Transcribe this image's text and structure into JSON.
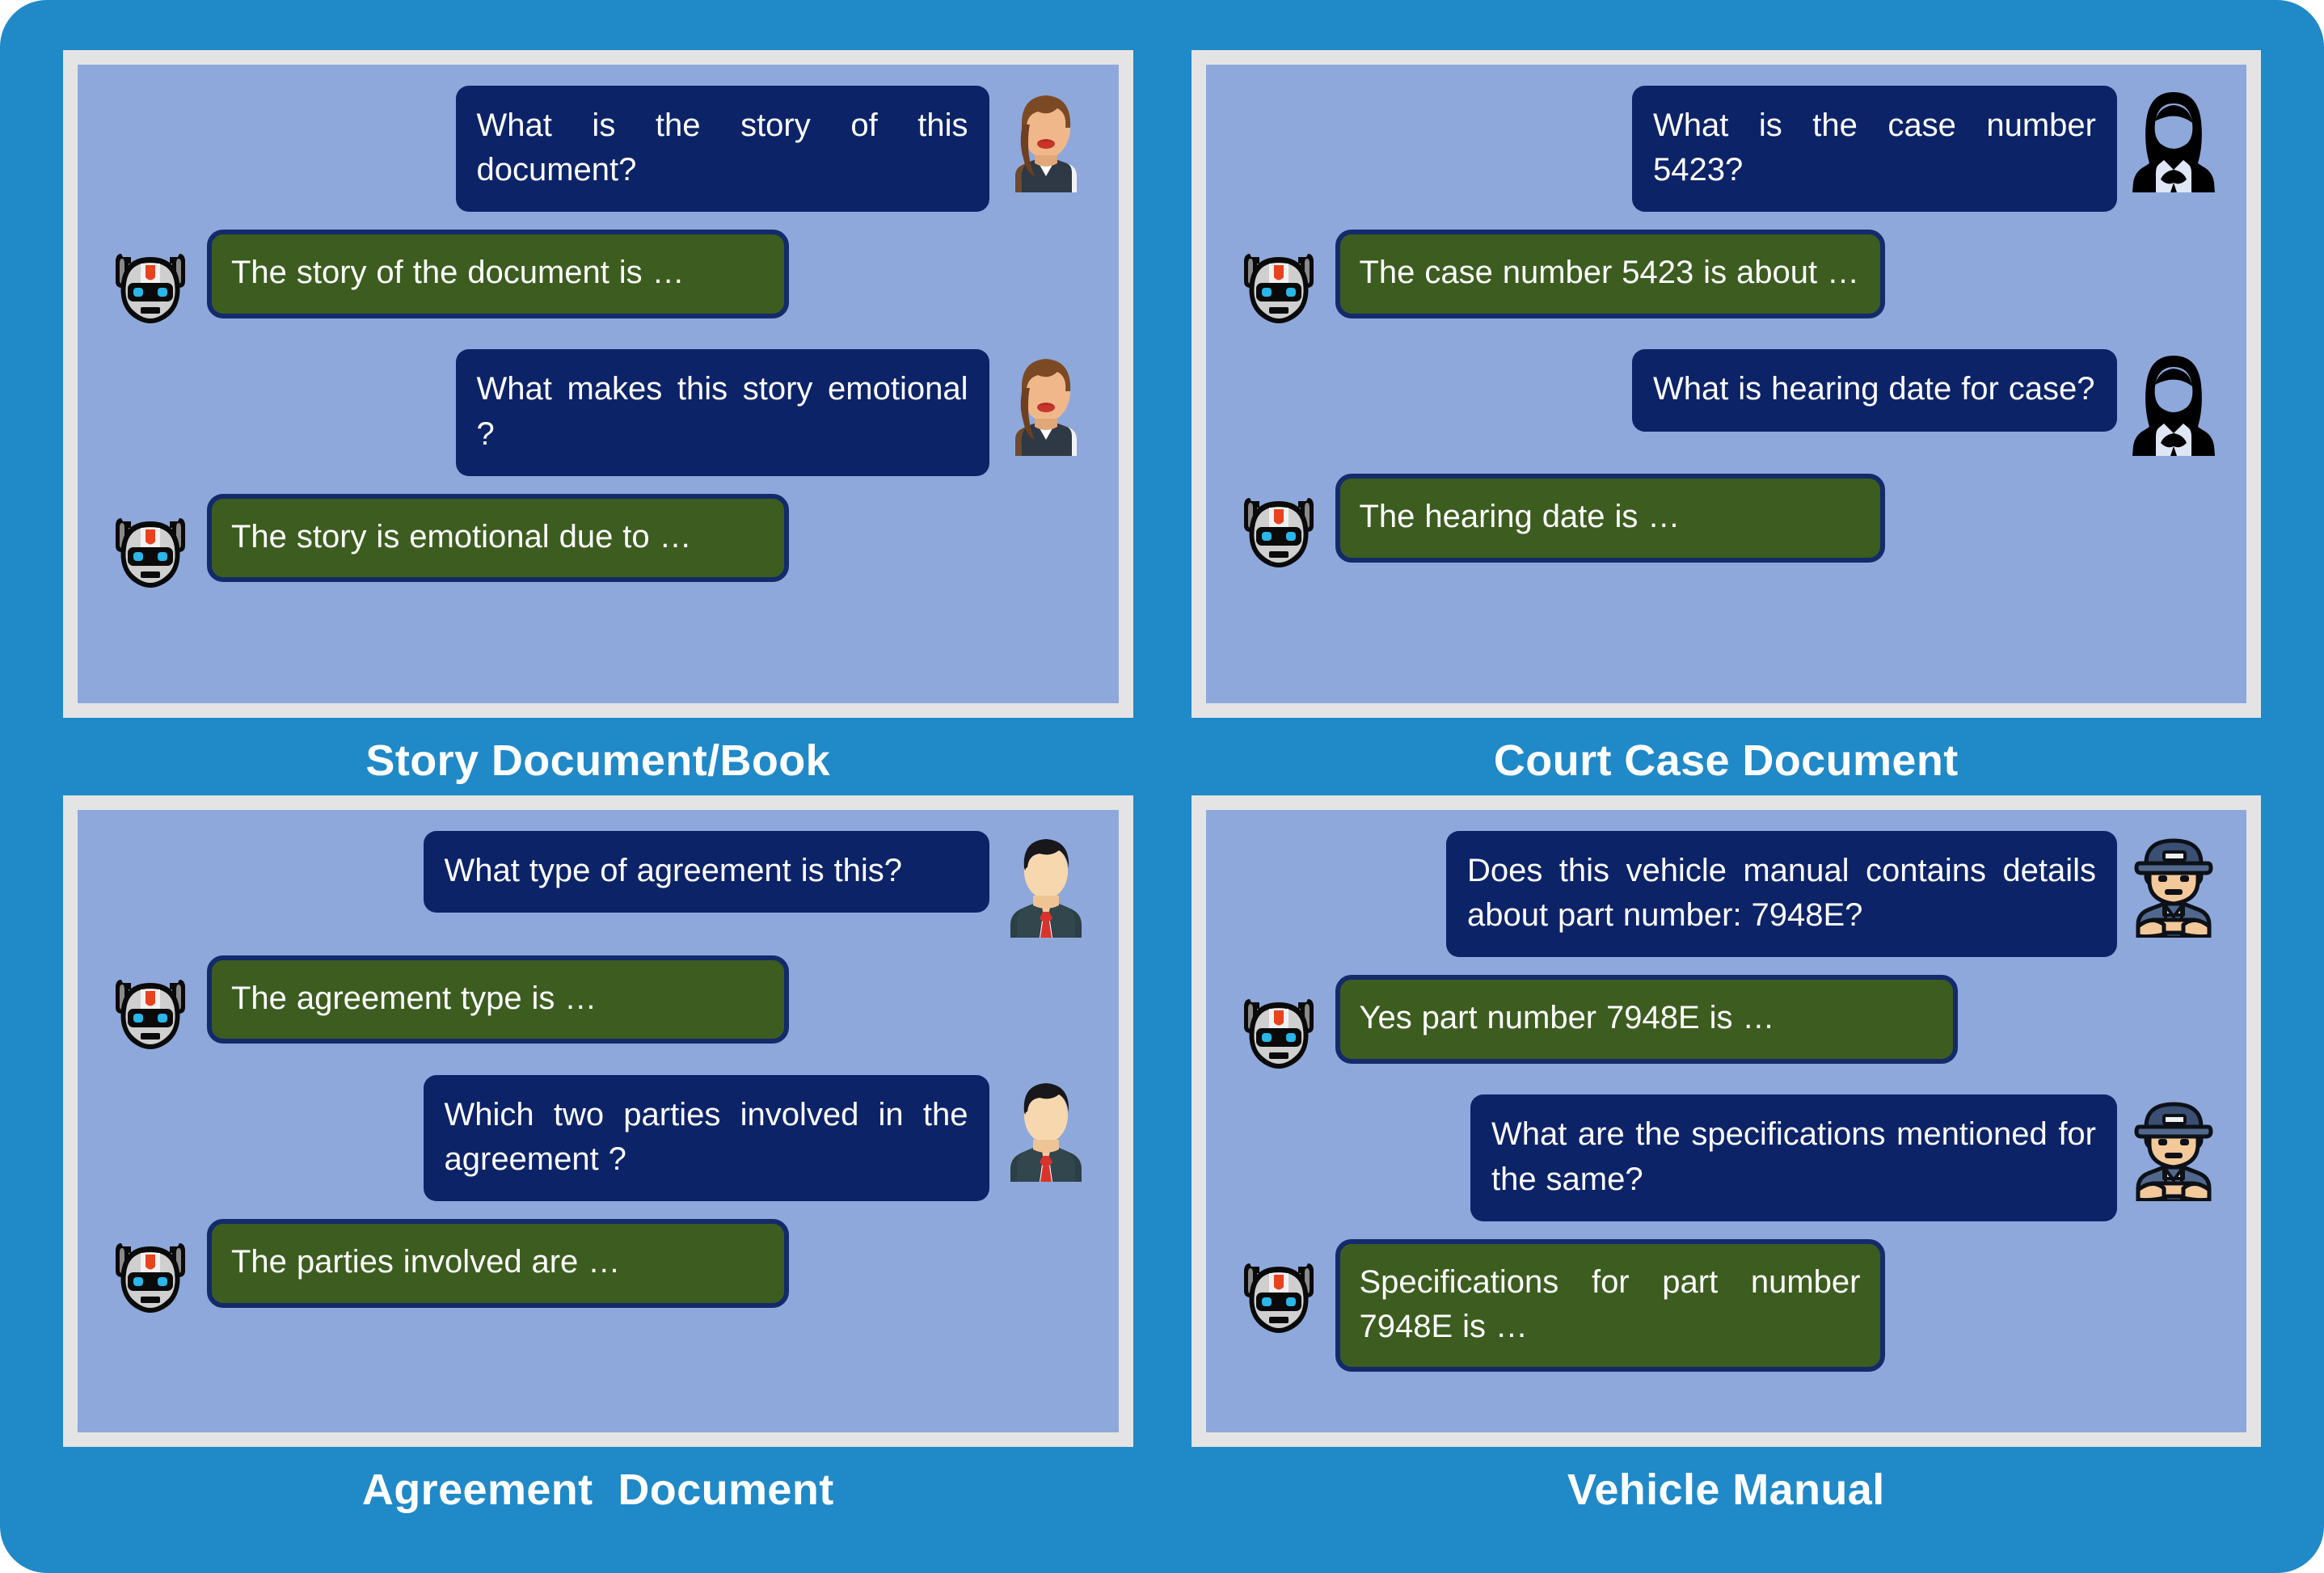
{
  "theme": {
    "canvas_bg": "#2089c8",
    "panel_frame": "#e4e4e4",
    "chat_bg": "#8ea8dc",
    "user_bubble": "#0d2368",
    "bot_bubble": "#3d5c20",
    "bot_bubble_border": "#132a6b",
    "caption_color": "#ffffff",
    "bubble_text": "#ffffff"
  },
  "panels": [
    {
      "id": "story-document",
      "caption": "Story Document/Book",
      "user_avatar": "woman-avatar",
      "bot_avatar": "robot-avatar",
      "messages": [
        {
          "role": "user",
          "text": "What is the story of this document?"
        },
        {
          "role": "bot",
          "text": "The story of the document is …"
        },
        {
          "role": "user",
          "text": "What makes this story emotional ?"
        },
        {
          "role": "bot",
          "text": "The story is emotional due to …"
        }
      ]
    },
    {
      "id": "court-case-document",
      "caption": "Court Case Document",
      "user_avatar": "lawyer-silhouette-avatar",
      "bot_avatar": "robot-avatar",
      "messages": [
        {
          "role": "user",
          "text": "What is the case number 5423?"
        },
        {
          "role": "bot",
          "text": "The case number 5423 is about …"
        },
        {
          "role": "user",
          "text": "What is hearing date for case?"
        },
        {
          "role": "bot",
          "text": "The hearing date is …"
        }
      ]
    },
    {
      "id": "agreement-document",
      "caption": "Agreement  Document",
      "user_avatar": "businessman-avatar",
      "bot_avatar": "robot-avatar",
      "messages": [
        {
          "role": "user",
          "text": "What type of agreement is this?"
        },
        {
          "role": "bot",
          "text": "The agreement type is …"
        },
        {
          "role": "user",
          "text": "Which two parties involved in the agreement ?"
        },
        {
          "role": "bot",
          "text": "The parties involved are …"
        }
      ]
    },
    {
      "id": "vehicle-manual",
      "caption": "Vehicle Manual",
      "user_avatar": "mechanic-avatar",
      "bot_avatar": "robot-avatar",
      "messages": [
        {
          "role": "user",
          "text": "Does this vehicle manual contains details about part number: 7948E?"
        },
        {
          "role": "bot",
          "text": "Yes part number 7948E is …"
        },
        {
          "role": "user",
          "text": "What are the specifications mentioned for the same?"
        },
        {
          "role": "bot",
          "text": "Specifications for part number 7948E is …"
        }
      ]
    }
  ]
}
